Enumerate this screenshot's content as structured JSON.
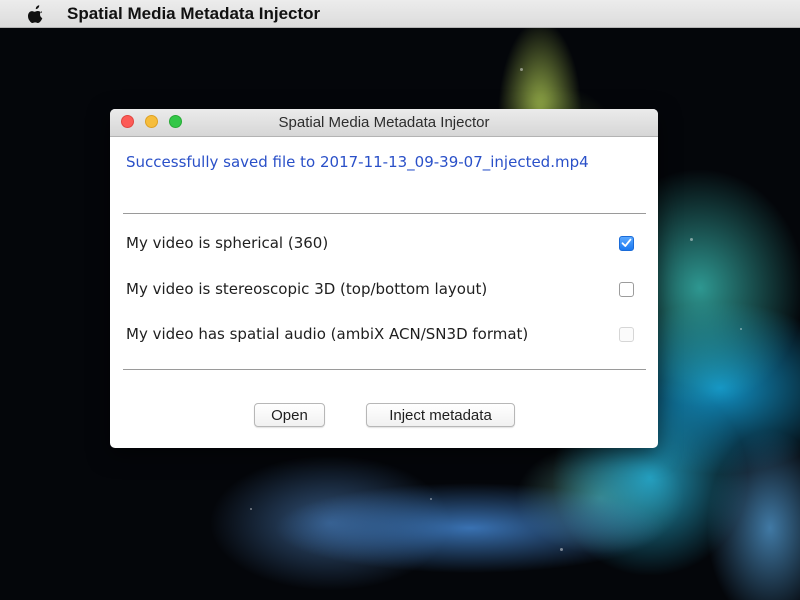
{
  "menubar": {
    "app_name": "Spatial Media Metadata Injector",
    "apple_icon": "apple-logo-icon"
  },
  "window": {
    "title": "Spatial Media Metadata Injector",
    "status_message": "Successfully saved file to 2017-11-13_09-39-07_injected.mp4",
    "options": [
      {
        "label": "My video is spherical (360)",
        "checked": true,
        "enabled": true
      },
      {
        "label": "My video is stereoscopic 3D (top/bottom layout)",
        "checked": false,
        "enabled": true
      },
      {
        "label": "My video has spatial audio (ambiX ACN/SN3D format)",
        "checked": false,
        "enabled": false
      }
    ],
    "buttons": {
      "open_label": "Open",
      "inject_label": "Inject metadata"
    }
  },
  "colors": {
    "status_text": "#2a50c8",
    "checkbox_accent": "#1a78f0",
    "close": "#fc5b57",
    "minimize": "#f6bd3c",
    "maximize": "#33c748"
  }
}
